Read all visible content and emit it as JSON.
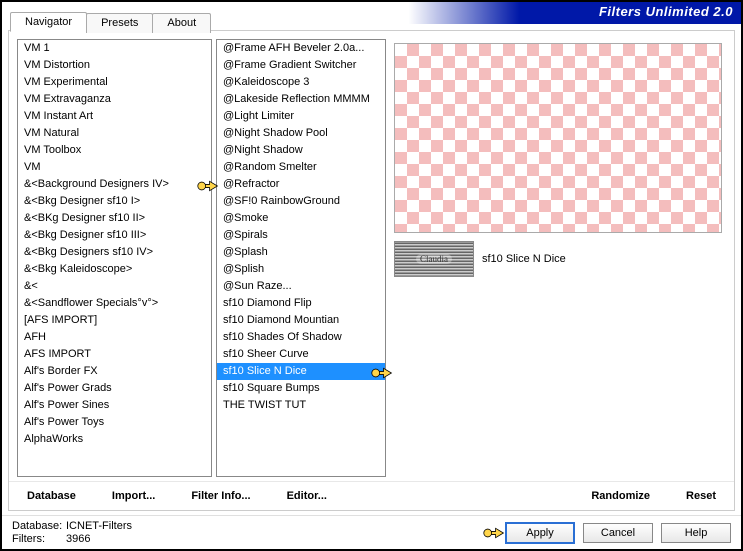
{
  "header": {
    "title": "Filters Unlimited 2.0"
  },
  "tabs": [
    {
      "label": "Navigator",
      "active": true
    },
    {
      "label": "Presets",
      "active": false
    },
    {
      "label": "About",
      "active": false
    }
  ],
  "categories": [
    "VM 1",
    "VM Distortion",
    "VM Experimental",
    "VM Extravaganza",
    "VM Instant Art",
    "VM Natural",
    "VM Toolbox",
    "VM",
    "&<Background Designers IV>",
    "&<Bkg Designer sf10 I>",
    "&<BKg Designer sf10 II>",
    "&<Bkg Designer sf10 III>",
    "&<Bkg Designers sf10 IV>",
    "&<Bkg Kaleidoscope>",
    "&<",
    "&<Sandflower Specials°v°>",
    "[AFS IMPORT]",
    "AFH",
    "AFS IMPORT",
    "Alf's Border FX",
    "Alf's Power Grads",
    "Alf's Power Sines",
    "Alf's Power Toys",
    "AlphaWorks"
  ],
  "category_selected_index": 8,
  "filters": [
    "@Frame AFH Beveler 2.0a...",
    "@Frame Gradient Switcher",
    "@Kaleidoscope 3",
    "@Lakeside Reflection MMMM",
    "@Light Limiter",
    "@Night Shadow Pool",
    "@Night Shadow",
    "@Random Smelter",
    "@Refractor",
    "@SF!0 RainbowGround",
    "@Smoke",
    "@Spirals",
    "@Splash",
    "@Splish",
    "@Sun Raze...",
    "sf10 Diamond Flip",
    "sf10 Diamond Mountian",
    "sf10 Shades Of Shadow",
    "sf10 Sheer Curve",
    "sf10 Slice N Dice",
    "sf10 Square Bumps",
    "THE TWIST TUT"
  ],
  "filter_selected_index": 19,
  "selected_filter_name": "sf10 Slice N Dice",
  "toolbar": {
    "database": "Database",
    "import": "Import...",
    "filter_info": "Filter Info...",
    "editor": "Editor...",
    "randomize": "Randomize",
    "reset": "Reset"
  },
  "footer": {
    "db_label": "Database:",
    "db_value": "ICNET-Filters",
    "filters_label": "Filters:",
    "filters_value": "3966",
    "apply": "Apply",
    "cancel": "Cancel",
    "help": "Help"
  }
}
